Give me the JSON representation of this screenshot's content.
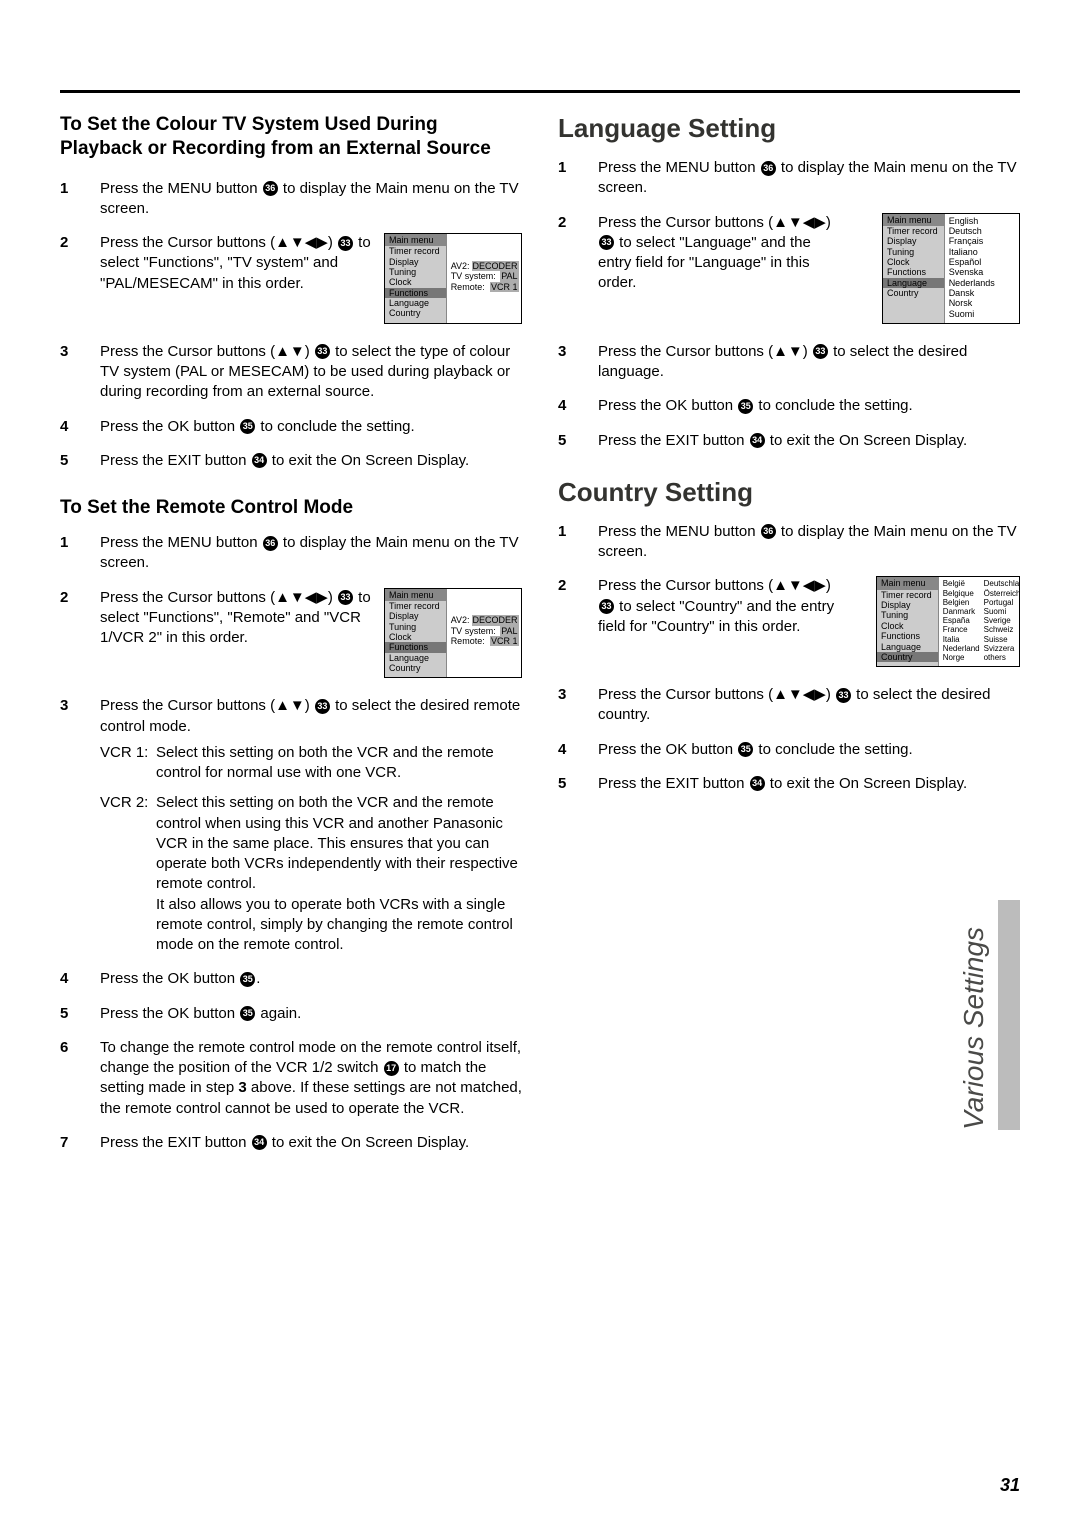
{
  "rule": true,
  "left": {
    "colour_tv": {
      "title": "To Set the Colour TV System Used During Playback or Recording from an External Source",
      "steps": [
        {
          "text_a": "Press the MENU button ",
          "btn": "36",
          "text_b": " to display the Main menu on the TV screen."
        },
        {
          "text_a": "Press the Cursor buttons (▲▼◀▶) ",
          "btn": "33",
          "text_b": " to select \"Functions\", \"TV system\" and \"PAL/MESECAM\" in this order."
        },
        {
          "text_a": "Press the Cursor buttons (▲▼) ",
          "btn": "33",
          "text_b": " to select the type of colour TV system (PAL or MESECAM) to be used during playback or during recording from an external source."
        },
        {
          "text_a": "Press the OK button ",
          "btn": "35",
          "text_b": " to conclude the setting."
        },
        {
          "text_a": "Press the EXIT button ",
          "btn": "34",
          "text_b": " to exit the On Screen Display."
        }
      ],
      "osd": {
        "title": "Main menu",
        "items": [
          "Timer record",
          "Display",
          "Tuning",
          "Clock",
          "Functions",
          "Language",
          "Country"
        ],
        "highlight": "Functions",
        "right": [
          {
            "k": "AV2:",
            "v": "DECODER"
          },
          {
            "k": "TV system:",
            "v": "PAL"
          },
          {
            "k": "Remote:",
            "v": "VCR 1"
          }
        ]
      }
    },
    "remote": {
      "title": "To Set the Remote Control Mode",
      "steps_top": [
        {
          "text_a": "Press the MENU button ",
          "btn": "36",
          "text_b": " to display the Main menu on the TV screen."
        },
        {
          "text_a": "Press the Cursor buttons (▲▼◀▶) ",
          "btn": "33",
          "text_b": " to select \"Functions\", \"Remote\" and \"VCR 1/VCR 2\" in this order."
        },
        {
          "text_a": "Press the Cursor buttons (▲▼) ",
          "btn": "33",
          "text_b": " to select the desired remote control mode."
        }
      ],
      "osd": {
        "title": "Main menu",
        "items": [
          "Timer record",
          "Display",
          "Tuning",
          "Clock",
          "Functions",
          "Language",
          "Country"
        ],
        "highlight": "Functions",
        "right": [
          {
            "k": "AV2:",
            "v": "DECODER"
          },
          {
            "k": "TV system:",
            "v": "PAL"
          },
          {
            "k": "Remote:",
            "v": "VCR 1"
          }
        ]
      },
      "vcr1_label": "VCR 1:",
      "vcr1_desc": "Select this setting on both the VCR and the remote control for normal use with one VCR.",
      "vcr2_label": "VCR 2:",
      "vcr2_desc": "Select this setting on both the VCR and the remote control when using this VCR and another Panasonic VCR in the same place. This ensures that you can operate both VCRs independently with their respective remote control.\nIt also allows you to operate both VCRs with a single remote control, simply by changing the remote control mode on the remote control.",
      "steps_bottom": [
        {
          "text_a": "Press the OK button ",
          "btn": "35",
          "text_b": "."
        },
        {
          "text_a": "Press the OK button ",
          "btn": "35",
          "text_b": " again."
        },
        {
          "text_a": "To change the remote control mode on the remote control itself, change the position of the VCR 1/2 switch ",
          "btn": "17",
          "text_b_before_bold": " to match the setting made in step ",
          "bold": "3",
          "text_b": " above. If these settings are not matched, the remote control cannot be used to operate the VCR."
        },
        {
          "text_a": "Press the EXIT button ",
          "btn": "34",
          "text_b": " to exit the On Screen Display."
        }
      ]
    }
  },
  "right": {
    "language": {
      "title": "Language Setting",
      "steps": [
        {
          "text_a": "Press the MENU button ",
          "btn": "36",
          "text_b": " to display the Main menu on the TV screen."
        },
        {
          "text_a": "Press the Cursor buttons (▲▼◀▶) ",
          "btn": "33",
          "text_b": " to select \"Language\" and the entry field for \"Language\" in this order."
        },
        {
          "text_a": "Press the Cursor buttons (▲▼) ",
          "btn": "33",
          "text_b": " to select the desired language."
        },
        {
          "text_a": "Press the OK button ",
          "btn": "35",
          "text_b": " to conclude the setting."
        },
        {
          "text_a": "Press the EXIT button ",
          "btn": "34",
          "text_b": " to exit the On Screen Display."
        }
      ],
      "osd": {
        "title": "Main menu",
        "items": [
          "Timer record",
          "Display",
          "Tuning",
          "Clock",
          "Functions",
          "Language",
          "Country"
        ],
        "highlight": "Language",
        "languages": [
          "English",
          "Deutsch",
          "Français",
          "Italiano",
          "Español",
          "Svenska",
          "Nederlands",
          "Dansk",
          "Norsk",
          "Suomi"
        ]
      }
    },
    "country": {
      "title": "Country Setting",
      "steps": [
        {
          "text_a": "Press the MENU button ",
          "btn": "36",
          "text_b": " to display the Main menu on the TV screen."
        },
        {
          "text_a": "Press the Cursor buttons (▲▼◀▶) ",
          "btn": "33",
          "text_b": " to select \"Country\" and the entry field for \"Country\" in this order."
        },
        {
          "text_a": "Press the Cursor buttons (▲▼◀▶) ",
          "btn": "33",
          "text_b": " to select the desired country."
        },
        {
          "text_a": "Press the OK button ",
          "btn": "35",
          "text_b": " to conclude the setting."
        },
        {
          "text_a": "Press the EXIT button ",
          "btn": "34",
          "text_b": " to exit the On Screen Display."
        }
      ],
      "osd": {
        "title": "Main menu",
        "items": [
          "Timer record",
          "Display",
          "Tuning",
          "Clock",
          "Functions",
          "Language",
          "Country"
        ],
        "highlight": "Country",
        "countries_left": [
          "België",
          "Belgique",
          "Belgien",
          "Danmark",
          "España",
          "France",
          "Italia",
          "Nederland",
          "Norge"
        ],
        "countries_right": [
          "Deutschland",
          "Österreich",
          "Portugal",
          "Suomi",
          "Sverige",
          "Schweiz",
          "Suisse",
          "Svizzera",
          "others"
        ]
      }
    }
  },
  "side_label": "Various Settings",
  "page_number": "31"
}
